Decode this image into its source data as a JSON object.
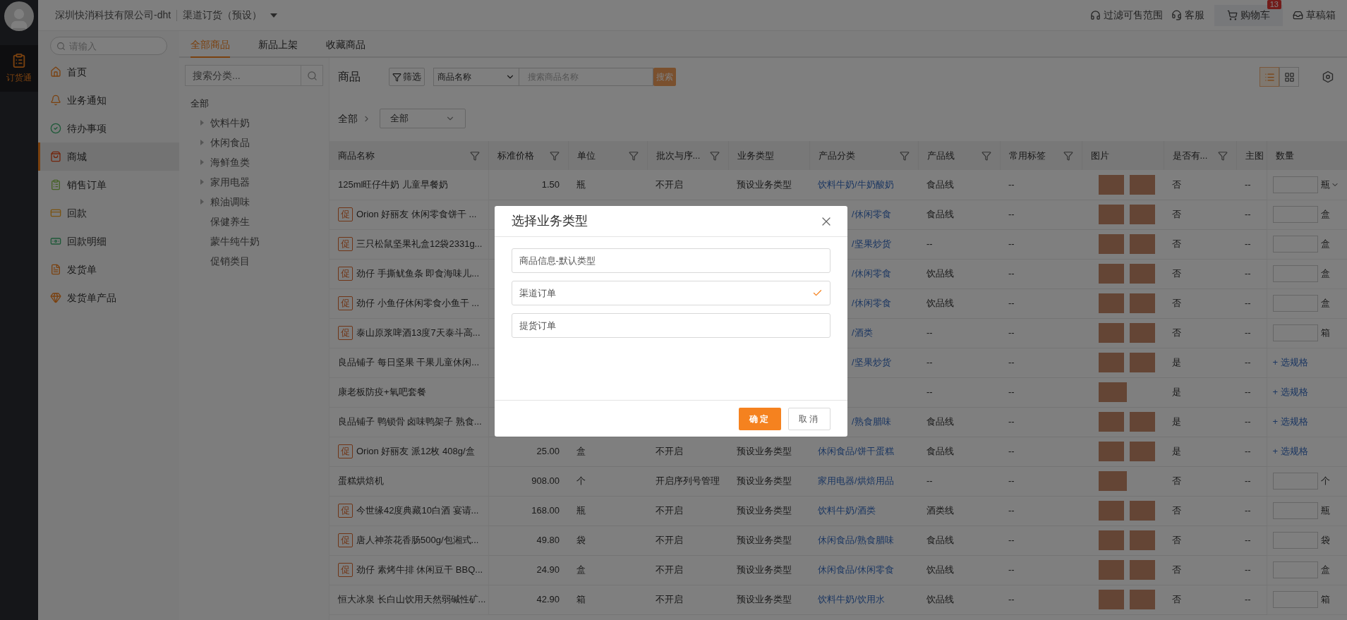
{
  "rail": {
    "app": {
      "label": "订货通",
      "selected": true
    }
  },
  "topbar": {
    "company": "深圳快消科技有限公司-dht",
    "channel": "渠道订货（预设）",
    "links": [
      {
        "label": "过滤可售范围",
        "kind": "headphones"
      },
      {
        "label": "客服",
        "kind": "headset"
      },
      {
        "label": "购物车",
        "kind": "cart",
        "badge": "13"
      },
      {
        "label": "草稿箱",
        "kind": "inbox"
      }
    ]
  },
  "sidebar": {
    "search_placeholder": "请输入",
    "items": [
      {
        "label": "首页",
        "selected": false
      },
      {
        "label": "业务通知",
        "selected": false
      },
      {
        "label": "待办事项",
        "selected": false
      },
      {
        "label": "商城",
        "selected": true
      },
      {
        "label": "销售订单",
        "selected": false
      },
      {
        "label": "回款",
        "selected": false
      },
      {
        "label": "回款明细",
        "selected": false
      },
      {
        "label": "发货单",
        "selected": false
      },
      {
        "label": "发货单产品",
        "selected": false
      }
    ]
  },
  "tabs": [
    {
      "label": "全部商品",
      "selected": true
    },
    {
      "label": "新品上架",
      "selected": false
    },
    {
      "label": "收藏商品",
      "selected": false
    }
  ],
  "category_panel": {
    "search_placeholder": "搜索分类...",
    "tree": {
      "label": "全部",
      "children": [
        {
          "label": "饮料牛奶",
          "expanded": false
        },
        {
          "label": "休闲食品",
          "expanded": false
        },
        {
          "label": "海鲜鱼类",
          "expanded": false
        },
        {
          "label": "家用电器",
          "expanded": false
        },
        {
          "label": "粮油调味",
          "expanded": false
        },
        {
          "label": "保健养生"
        },
        {
          "label": "蒙牛纯牛奶"
        },
        {
          "label": "促销类目"
        }
      ]
    }
  },
  "toolbar": {
    "title": "商品",
    "filter_button": "筛选",
    "field_select": "商品名称",
    "search_placeholder": "搜索商品名称",
    "search_button": "搜索",
    "views": [
      {
        "kind": "list",
        "selected": true
      },
      {
        "kind": "grid",
        "selected": false
      }
    ]
  },
  "breadcrumb": {
    "root": "全部",
    "select": "全部"
  },
  "table": {
    "columns": [
      {
        "label": "商品名称",
        "filter": true
      },
      {
        "label": "标准价格",
        "filter": true
      },
      {
        "label": "单位",
        "filter": true
      },
      {
        "label": "批次与序...",
        "filter": true
      },
      {
        "label": "业务类型",
        "filter": false
      },
      {
        "label": "产品分类",
        "filter": true
      },
      {
        "label": "产品线",
        "filter": true
      },
      {
        "label": "常用标签",
        "filter": true
      },
      {
        "label": "图片",
        "filter": false
      },
      {
        "label": "是否有...",
        "filter": true
      },
      {
        "label": "主图",
        "filter": false
      },
      {
        "label": "数量",
        "filter": false
      }
    ],
    "rows": [
      {
        "name": "125ml旺仔牛奶 儿童早餐奶",
        "price": "1.50",
        "unit": "瓶",
        "batch": "不开启",
        "biz": "预设业务类型",
        "category": "饮料牛奶/牛奶酸奶",
        "line": "食品线",
        "tag": "--",
        "photos": [
          {
            "kind": "photo"
          },
          {
            "kind": "photo"
          }
        ],
        "spec": "否",
        "main": "--",
        "qty": {
          "kind": "input",
          "unit": "瓶",
          "dropdown": true
        }
      },
      {
        "badge": "促",
        "name": "Orion 好丽友 休闲零食饼干 ...",
        "category_visible": "/休闲零食",
        "line": "食品线",
        "tag": "--",
        "photos": [
          {
            "kind": "photo"
          },
          {
            "kind": "photo"
          }
        ],
        "spec": "否",
        "main": "--",
        "qty": {
          "kind": "input",
          "unit": "盒",
          "dropdown": false
        }
      },
      {
        "badge": "促",
        "name": "三只松鼠坚果礼盒12袋2331g...",
        "category_visible": "/坚果炒货",
        "line": "--",
        "tag": "--",
        "photos": [
          {
            "kind": "photo"
          },
          {
            "kind": "photo"
          }
        ],
        "spec": "否",
        "main": "--",
        "qty": {
          "kind": "input",
          "unit": "盒",
          "dropdown": false
        }
      },
      {
        "badge": "促",
        "name": "劲仔 手撕鱿鱼条 即食海味儿...",
        "category_visible": "/休闲零食",
        "line": "饮品线",
        "tag": "--",
        "photos": [
          {
            "kind": "photo"
          },
          {
            "kind": "photo"
          }
        ],
        "spec": "否",
        "main": "--",
        "qty": {
          "kind": "input",
          "unit": "盒",
          "dropdown": false
        }
      },
      {
        "badge": "促",
        "name": "劲仔 小鱼仔休闲零食小鱼干 ...",
        "category_visible": "/休闲零食",
        "line": "饮品线",
        "tag": "--",
        "photos": [
          {
            "kind": "photo"
          },
          {
            "kind": "photo"
          }
        ],
        "spec": "否",
        "main": "--",
        "qty": {
          "kind": "input",
          "unit": "盒",
          "dropdown": false
        }
      },
      {
        "badge": "促",
        "name": "泰山原浆啤酒13度7天泰斗高...",
        "category_visible": "/酒类",
        "line": "--",
        "tag": "--",
        "photos": [
          {
            "kind": "photo"
          },
          {
            "kind": "photo"
          }
        ],
        "spec": "否",
        "main": "--",
        "qty": {
          "kind": "input",
          "unit": "箱",
          "dropdown": false
        }
      },
      {
        "name": "良品铺子 每日坚果 干果儿童休闲...",
        "category_visible": "/坚果炒货",
        "line": "--",
        "tag": "--",
        "photos": [
          {
            "kind": "photo"
          },
          {
            "kind": "photo"
          }
        ],
        "spec": "是",
        "main": "--",
        "qty": {
          "kind": "link",
          "label": "+ 选规格"
        }
      },
      {
        "name": "康老板防疫+氧吧套餐",
        "line": "--",
        "tag": "--",
        "photos": [
          {
            "kind": "photo"
          }
        ],
        "spec": "是",
        "main": "--",
        "qty": {
          "kind": "link",
          "label": "+ 选规格"
        }
      },
      {
        "name": "良品铺子 鸭锁骨 卤味鸭架子 熟食...",
        "category_visible": "/熟食腊味",
        "line": "食品线",
        "tag": "--",
        "photos": [
          {
            "kind": "photo"
          },
          {
            "kind": "photo"
          }
        ],
        "spec": "是",
        "main": "--",
        "qty": {
          "kind": "link",
          "label": "+ 选规格"
        }
      },
      {
        "badge": "促",
        "name": "Orion 好丽友 派12枚 408g/盒",
        "price": "25.00",
        "unit": "盒",
        "batch": "不开启",
        "biz": "预设业务类型",
        "category": "休闲食品/饼干蛋糕",
        "line": "食品线",
        "tag": "--",
        "photos": [
          {
            "kind": "photo"
          },
          {
            "kind": "photo"
          }
        ],
        "spec": "是",
        "main": "--",
        "qty": {
          "kind": "link",
          "label": "+ 选规格"
        }
      },
      {
        "name": "蛋糕烘焙机",
        "price": "908.00",
        "unit": "个",
        "batch": "开启序列号管理",
        "biz": "预设业务类型",
        "category": "家用电器/烘焙用品",
        "line": "--",
        "tag": "--",
        "photos": [
          {
            "kind": "photo"
          }
        ],
        "spec": "否",
        "main": "--",
        "qty": {
          "kind": "input",
          "unit": "个",
          "dropdown": false
        }
      },
      {
        "badge": "促",
        "name": "今世缘42度典藏10白酒 宴请...",
        "price": "168.00",
        "unit": "瓶",
        "batch": "不开启",
        "biz": "预设业务类型",
        "category": "饮料牛奶/酒类",
        "line": "酒类线",
        "tag": "--",
        "photos": [
          {
            "kind": "photo"
          },
          {
            "kind": "photo"
          }
        ],
        "spec": "否",
        "main": "--",
        "qty": {
          "kind": "input",
          "unit": "瓶",
          "dropdown": false
        }
      },
      {
        "badge": "促",
        "name": "唐人神茶花香肠500g/包湘式...",
        "price": "49.80",
        "unit": "袋",
        "batch": "不开启",
        "biz": "预设业务类型",
        "category": "休闲食品/熟食腊味",
        "line": "食品线",
        "tag": "--",
        "photos": [
          {
            "kind": "photo"
          },
          {
            "kind": "photo"
          }
        ],
        "spec": "否",
        "main": "--",
        "qty": {
          "kind": "input",
          "unit": "袋",
          "dropdown": false
        }
      },
      {
        "badge": "促",
        "name": "劲仔 素烤牛排 休闲豆干 BBQ...",
        "price": "24.90",
        "unit": "盒",
        "batch": "不开启",
        "biz": "预设业务类型",
        "category": "休闲食品/休闲零食",
        "line": "饮品线",
        "tag": "--",
        "photos": [
          {
            "kind": "photo"
          },
          {
            "kind": "photo"
          }
        ],
        "spec": "否",
        "main": "--",
        "qty": {
          "kind": "input",
          "unit": "盒",
          "dropdown": false
        }
      },
      {
        "name": "恒大冰泉 长白山饮用天然弱碱性矿...",
        "price": "42.90",
        "unit": "箱",
        "batch": "不开启",
        "biz": "预设业务类型",
        "category": "饮料牛奶/饮用水",
        "line": "饮品线",
        "tag": "--",
        "photos": [
          {
            "kind": "photo"
          },
          {
            "kind": "photo"
          }
        ],
        "spec": "否",
        "main": "--",
        "qty": {
          "kind": "input",
          "unit": "箱",
          "dropdown": false
        }
      }
    ]
  },
  "dialog": {
    "title": "选择业务类型",
    "options": [
      {
        "label": "商品信息-默认类型",
        "selected": false
      },
      {
        "label": "渠道订单",
        "selected": true
      },
      {
        "label": "提货订单",
        "selected": false
      }
    ],
    "ok": "确定",
    "cancel": "取消"
  }
}
